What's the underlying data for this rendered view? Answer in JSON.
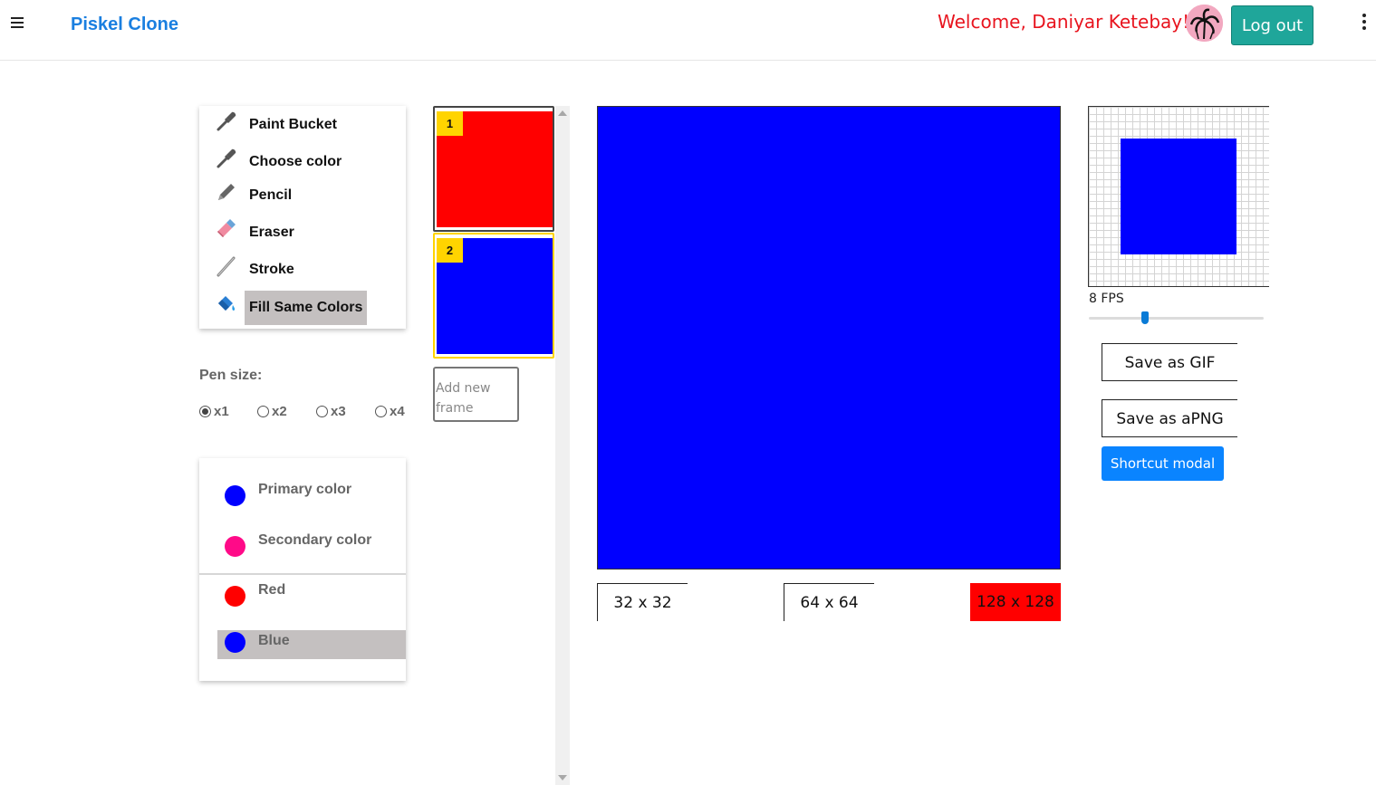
{
  "header": {
    "app_title": "Piskel Clone",
    "welcome": "Welcome, Daniyar Ketebay!",
    "logout_label": "Log out"
  },
  "tools": [
    {
      "label": "Paint Bucket",
      "icon": "dropper-icon",
      "active": false
    },
    {
      "label": "Choose color",
      "icon": "dropper-icon",
      "active": false
    },
    {
      "label": "Pencil",
      "icon": "pencil-icon",
      "active": false
    },
    {
      "label": "Eraser",
      "icon": "eraser-icon",
      "active": false
    },
    {
      "label": "Stroke",
      "icon": "stroke-icon",
      "active": false
    },
    {
      "label": "Fill Same Colors",
      "icon": "paint-bucket-icon",
      "active": true
    }
  ],
  "pen_size": {
    "label": "Pen size:",
    "options": [
      "x1",
      "x2",
      "x3",
      "x4"
    ],
    "selected": "x1"
  },
  "colors": {
    "primary": {
      "label": "Primary color",
      "value": "#0000ff"
    },
    "secondary": {
      "label": "Secondary color",
      "value": "#ff0a88"
    },
    "palette": [
      {
        "label": "Red",
        "value": "#ff0000",
        "selected": false
      },
      {
        "label": "Blue",
        "value": "#0000ff",
        "selected": true
      }
    ]
  },
  "frames": [
    {
      "number": "1",
      "color": "#ff0000"
    },
    {
      "number": "2",
      "color": "#0000ff"
    }
  ],
  "add_frame_label": "Add new frame",
  "canvas": {
    "color": "#0000ff"
  },
  "canvas_sizes": [
    {
      "label": "32 x 32",
      "active": false
    },
    {
      "label": "64 x 64",
      "active": false
    },
    {
      "label": "128 x 128",
      "active": true
    }
  ],
  "preview": {
    "color": "#0000ff",
    "fps_label": "8 FPS",
    "fps_value": 8,
    "fps_min": 1,
    "fps_max": 24
  },
  "export": {
    "gif_label": "Save as GIF",
    "apng_label": "Save as aPNG",
    "shortcut_label": "Shortcut modal"
  }
}
